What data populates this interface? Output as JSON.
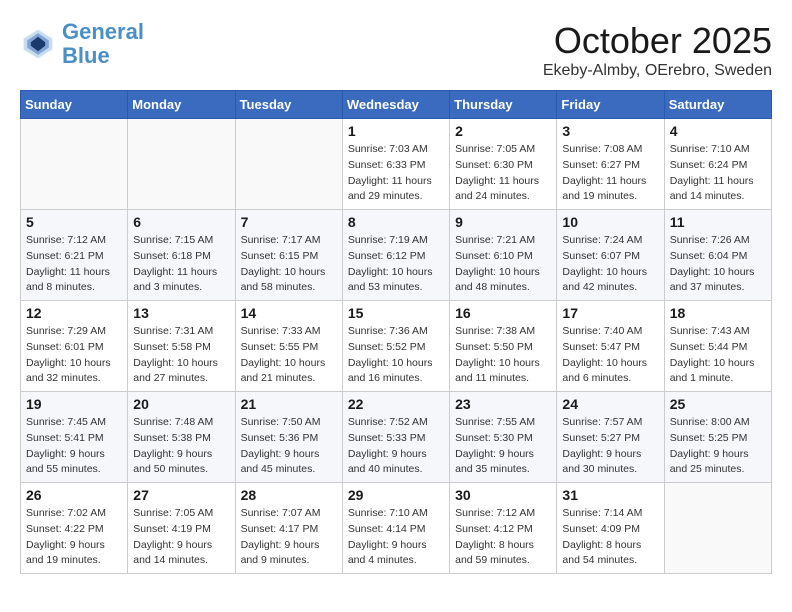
{
  "header": {
    "logo_line1": "General",
    "logo_line2": "Blue",
    "month": "October 2025",
    "location": "Ekeby-Almby, OErebro, Sweden"
  },
  "weekdays": [
    "Sunday",
    "Monday",
    "Tuesday",
    "Wednesday",
    "Thursday",
    "Friday",
    "Saturday"
  ],
  "weeks": [
    [
      {
        "day": "",
        "info": ""
      },
      {
        "day": "",
        "info": ""
      },
      {
        "day": "",
        "info": ""
      },
      {
        "day": "1",
        "info": "Sunrise: 7:03 AM\nSunset: 6:33 PM\nDaylight: 11 hours\nand 29 minutes."
      },
      {
        "day": "2",
        "info": "Sunrise: 7:05 AM\nSunset: 6:30 PM\nDaylight: 11 hours\nand 24 minutes."
      },
      {
        "day": "3",
        "info": "Sunrise: 7:08 AM\nSunset: 6:27 PM\nDaylight: 11 hours\nand 19 minutes."
      },
      {
        "day": "4",
        "info": "Sunrise: 7:10 AM\nSunset: 6:24 PM\nDaylight: 11 hours\nand 14 minutes."
      }
    ],
    [
      {
        "day": "5",
        "info": "Sunrise: 7:12 AM\nSunset: 6:21 PM\nDaylight: 11 hours\nand 8 minutes."
      },
      {
        "day": "6",
        "info": "Sunrise: 7:15 AM\nSunset: 6:18 PM\nDaylight: 11 hours\nand 3 minutes."
      },
      {
        "day": "7",
        "info": "Sunrise: 7:17 AM\nSunset: 6:15 PM\nDaylight: 10 hours\nand 58 minutes."
      },
      {
        "day": "8",
        "info": "Sunrise: 7:19 AM\nSunset: 6:12 PM\nDaylight: 10 hours\nand 53 minutes."
      },
      {
        "day": "9",
        "info": "Sunrise: 7:21 AM\nSunset: 6:10 PM\nDaylight: 10 hours\nand 48 minutes."
      },
      {
        "day": "10",
        "info": "Sunrise: 7:24 AM\nSunset: 6:07 PM\nDaylight: 10 hours\nand 42 minutes."
      },
      {
        "day": "11",
        "info": "Sunrise: 7:26 AM\nSunset: 6:04 PM\nDaylight: 10 hours\nand 37 minutes."
      }
    ],
    [
      {
        "day": "12",
        "info": "Sunrise: 7:29 AM\nSunset: 6:01 PM\nDaylight: 10 hours\nand 32 minutes."
      },
      {
        "day": "13",
        "info": "Sunrise: 7:31 AM\nSunset: 5:58 PM\nDaylight: 10 hours\nand 27 minutes."
      },
      {
        "day": "14",
        "info": "Sunrise: 7:33 AM\nSunset: 5:55 PM\nDaylight: 10 hours\nand 21 minutes."
      },
      {
        "day": "15",
        "info": "Sunrise: 7:36 AM\nSunset: 5:52 PM\nDaylight: 10 hours\nand 16 minutes."
      },
      {
        "day": "16",
        "info": "Sunrise: 7:38 AM\nSunset: 5:50 PM\nDaylight: 10 hours\nand 11 minutes."
      },
      {
        "day": "17",
        "info": "Sunrise: 7:40 AM\nSunset: 5:47 PM\nDaylight: 10 hours\nand 6 minutes."
      },
      {
        "day": "18",
        "info": "Sunrise: 7:43 AM\nSunset: 5:44 PM\nDaylight: 10 hours\nand 1 minute."
      }
    ],
    [
      {
        "day": "19",
        "info": "Sunrise: 7:45 AM\nSunset: 5:41 PM\nDaylight: 9 hours\nand 55 minutes."
      },
      {
        "day": "20",
        "info": "Sunrise: 7:48 AM\nSunset: 5:38 PM\nDaylight: 9 hours\nand 50 minutes."
      },
      {
        "day": "21",
        "info": "Sunrise: 7:50 AM\nSunset: 5:36 PM\nDaylight: 9 hours\nand 45 minutes."
      },
      {
        "day": "22",
        "info": "Sunrise: 7:52 AM\nSunset: 5:33 PM\nDaylight: 9 hours\nand 40 minutes."
      },
      {
        "day": "23",
        "info": "Sunrise: 7:55 AM\nSunset: 5:30 PM\nDaylight: 9 hours\nand 35 minutes."
      },
      {
        "day": "24",
        "info": "Sunrise: 7:57 AM\nSunset: 5:27 PM\nDaylight: 9 hours\nand 30 minutes."
      },
      {
        "day": "25",
        "info": "Sunrise: 8:00 AM\nSunset: 5:25 PM\nDaylight: 9 hours\nand 25 minutes."
      }
    ],
    [
      {
        "day": "26",
        "info": "Sunrise: 7:02 AM\nSunset: 4:22 PM\nDaylight: 9 hours\nand 19 minutes."
      },
      {
        "day": "27",
        "info": "Sunrise: 7:05 AM\nSunset: 4:19 PM\nDaylight: 9 hours\nand 14 minutes."
      },
      {
        "day": "28",
        "info": "Sunrise: 7:07 AM\nSunset: 4:17 PM\nDaylight: 9 hours\nand 9 minutes."
      },
      {
        "day": "29",
        "info": "Sunrise: 7:10 AM\nSunset: 4:14 PM\nDaylight: 9 hours\nand 4 minutes."
      },
      {
        "day": "30",
        "info": "Sunrise: 7:12 AM\nSunset: 4:12 PM\nDaylight: 8 hours\nand 59 minutes."
      },
      {
        "day": "31",
        "info": "Sunrise: 7:14 AM\nSunset: 4:09 PM\nDaylight: 8 hours\nand 54 minutes."
      },
      {
        "day": "",
        "info": ""
      }
    ]
  ]
}
